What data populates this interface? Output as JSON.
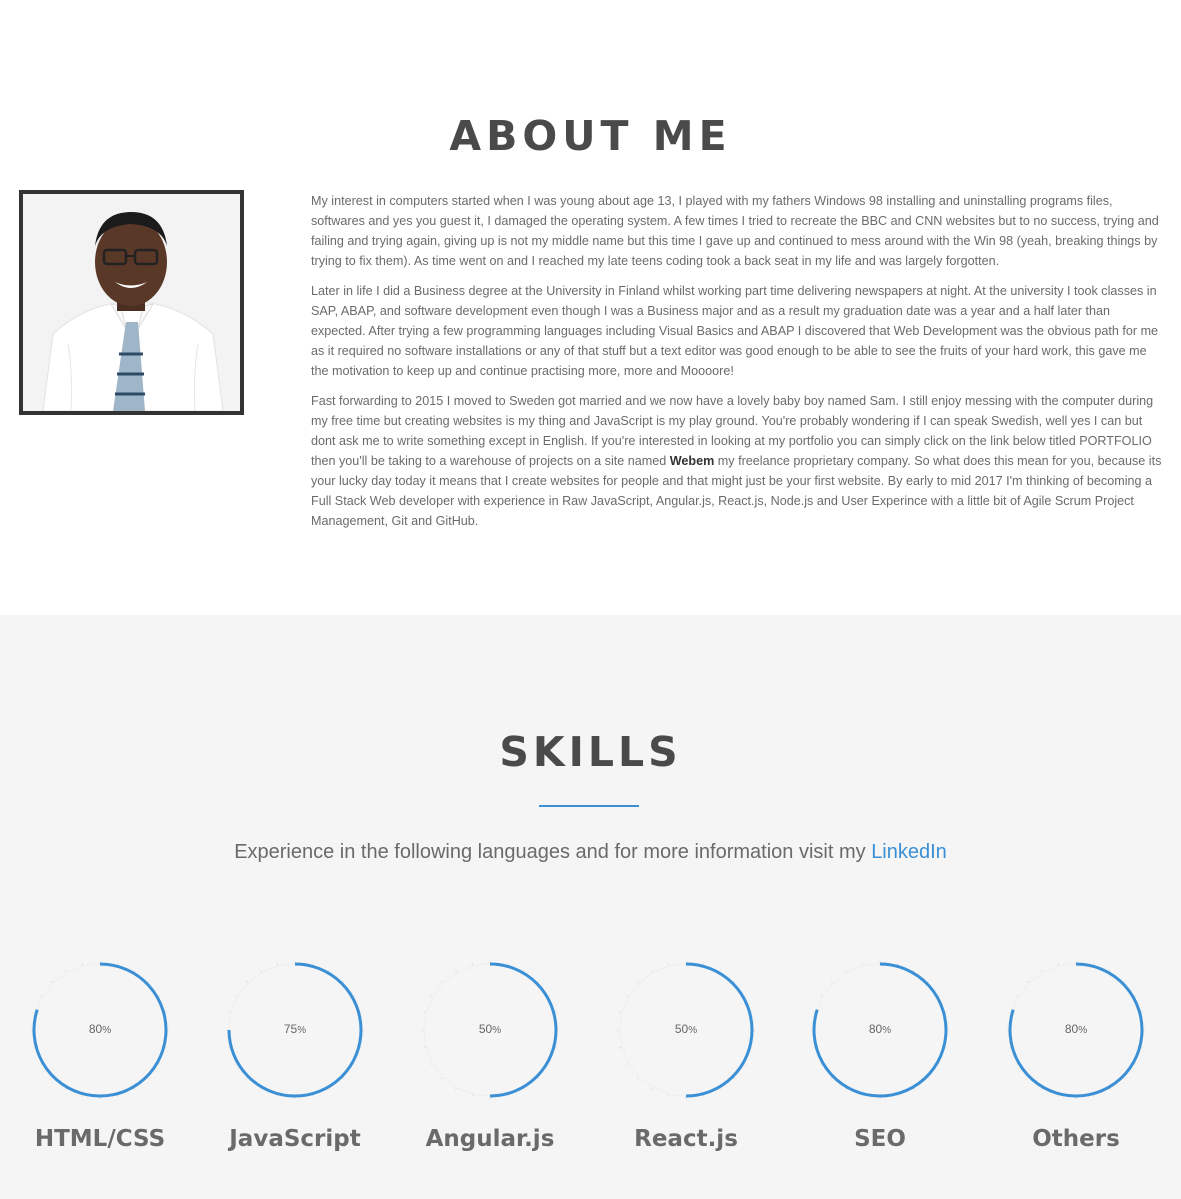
{
  "about": {
    "title": "ABOUT ME",
    "p1": "My interest in computers started when I was young about age 13, I played with my fathers Windows 98 installing and uninstalling programs files, softwares and yes you guest it, I damaged the operating system. A few times I tried to recreate the BBC and CNN websites but to no success, trying and failing and trying again, giving up is not my middle name but this time I gave up and continued to mess around with the Win 98 (yeah, breaking things by trying to fix them). As time went on and I reached my late teens coding took a back seat in my life and was largely forgotten.",
    "p2": "Later in life I did a Business degree at the University in Finland whilst working part time delivering newspapers at night. At the university I took classes in SAP, ABAP, and software development even though I was a Business major and as a result my graduation date was a year and a half later than expected. After trying a few programming languages including Visual Basics and ABAP I discovered that Web Development was the obvious path for me as it required no software installations or any of that stuff but a text editor was good enough to be able to see the fruits of your hard work, this gave me the motivation to keep up and continue practising more, more and Moooore!",
    "p3_before": "Fast forwarding to 2015 I moved to Sweden got married and we now have a lovely baby boy named Sam. I still enjoy messing with the computer during my free time but creating websites is my thing and JavaScript is my play ground. You're probably wondering if I can speak Swedish, well yes I can but dont ask me to write something except in English. If you're interested in looking at my portfolio you can simply click on the link below titled PORTFOLIO then you'll be taking to a warehouse of projects on a site named ",
    "p3_bold": "Webem",
    "p3_after": " my freelance proprietary company. So what does this mean for you, because its your lucky day today it means that I create websites for people and that might just be your first website. By early to mid 2017 I'm thinking of becoming a Full Stack Web developer with experience in Raw JavaScript, Angular.js, React.js, Node.js and User Experince with a little bit of Agile Scrum Project Management, Git and GitHub."
  },
  "skills": {
    "title": "SKILLS",
    "subtitle": "Experience in the following languages and for more information visit my ",
    "link": "LinkedIn",
    "accent": "#3a8fd5",
    "items": [
      {
        "name": "HTML/CSS",
        "value": "80",
        "percent": 80
      },
      {
        "name": "JavaScript",
        "value": "75",
        "percent": 75
      },
      {
        "name": "Angular.js",
        "value": "50",
        "percent": 50
      },
      {
        "name": "React.js",
        "value": "50",
        "percent": 50
      },
      {
        "name": "SEO",
        "value": "80",
        "percent": 80
      },
      {
        "name": "Others",
        "value": "80",
        "percent": 80
      }
    ],
    "pct_sign": "%"
  }
}
